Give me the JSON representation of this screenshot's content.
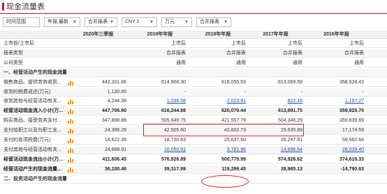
{
  "title": "现金流量表",
  "toolbar": {
    "range": "时间范围",
    "period": "年报,最新",
    "report": "合并报表",
    "currency": "CNY:1",
    "unit": "万元",
    "report2": "合并报表"
  },
  "columns": [
    "",
    "2020年三季报",
    "2019年年报",
    "2018年年报",
    "2017年年报",
    "2016年年报"
  ],
  "rows": [
    {
      "label": "上市前/上市后",
      "vals": [
        "",
        "上市后",
        "上市后",
        "上市后",
        "上市后"
      ],
      "type": "meta"
    },
    {
      "label": "报表类型",
      "vals": [
        "",
        "合并报表",
        "合并报表",
        "合并报表",
        "合并报表"
      ],
      "type": "meta"
    },
    {
      "label": "公司类型",
      "vals": [
        "",
        "通用",
        "通用",
        "通用",
        "通用"
      ],
      "type": "meta"
    },
    {
      "label": "一、经营活动产生的现金流量:",
      "vals": [
        "",
        "",
        "",
        "",
        ""
      ],
      "type": "section"
    },
    {
      "label": "销售商品、提供劳务收到...",
      "vals": [
        "442,331.66",
        "614,908.30",
        "618,055.53",
        "613,069.59",
        "358,628.43"
      ],
      "type": "item",
      "icon": true
    },
    {
      "label": "收到的税费返还(万元)",
      "vals": [
        "1,130.85",
        "-",
        "-",
        "-",
        "-"
      ],
      "type": "item"
    },
    {
      "label": "收到其他与经营活动有关...",
      "vals": [
        "4,244.39",
        "1,336.58",
        "2,023.91",
        "822.16",
        "1,197.27"
      ],
      "type": "item",
      "icon": true,
      "links": [
        1,
        2,
        3,
        4
      ]
    },
    {
      "label": "经营活动现金流入小计(万...",
      "vals": [
        "447,706.90",
        "616,244.88",
        "620,079.44",
        "613,891.75",
        "359,825.70"
      ],
      "type": "bold",
      "icon": true
    },
    {
      "label": "购买商品、接受劳务支付...",
      "vals": [
        "347,898.86",
        "505,649.75",
        "421,557.79",
        "504,346.29",
        "269,839.69"
      ],
      "type": "item",
      "icon": true
    },
    {
      "label": "支付给职工以及为职工支...",
      "vals": [
        "24,396.29",
        "42,505.60",
        "43,802.73",
        "29,635.89",
        "17,174.59"
      ],
      "type": "item",
      "icon": true
    },
    {
      "label": "支付的各项税费(万元)",
      "vals": [
        "14,622.39",
        "18,720.63",
        "25,637.50",
        "26,247.81",
        "59,562.64"
      ],
      "type": "item",
      "icon": true
    },
    {
      "label": "支付其他与经营活动有关...",
      "vals": [
        "24,688.91",
        "10,050.91",
        "9,781.96",
        "14,696.64",
        "28,039.40"
      ],
      "type": "item",
      "icon": true,
      "links": [
        1,
        2,
        3,
        4
      ]
    },
    {
      "label": "经营活动现金流出小计(万...",
      "vals": [
        "411,606.45",
        "576,926.89",
        "500,779.99",
        "574,926.62",
        "374,616.33"
      ],
      "type": "bold",
      "icon": true
    },
    {
      "label": "经营活动产生的现金流量...",
      "vals": [
        "36,100.46",
        "39,317.99",
        "119,299.45",
        "38,965.13",
        "-14,790.63"
      ],
      "type": "bold",
      "icon": true
    },
    {
      "label": "二、投资活动产生的现金流量:",
      "vals": [
        "",
        "",
        "",
        "",
        ""
      ],
      "type": "section"
    }
  ],
  "colors": {
    "accent": "#c8102e",
    "highlight": "#e02020",
    "icon": "#f0a030"
  },
  "icons": {
    "row_chart": "bar-chart-icon",
    "dropdown": "chevron-down-icon"
  }
}
